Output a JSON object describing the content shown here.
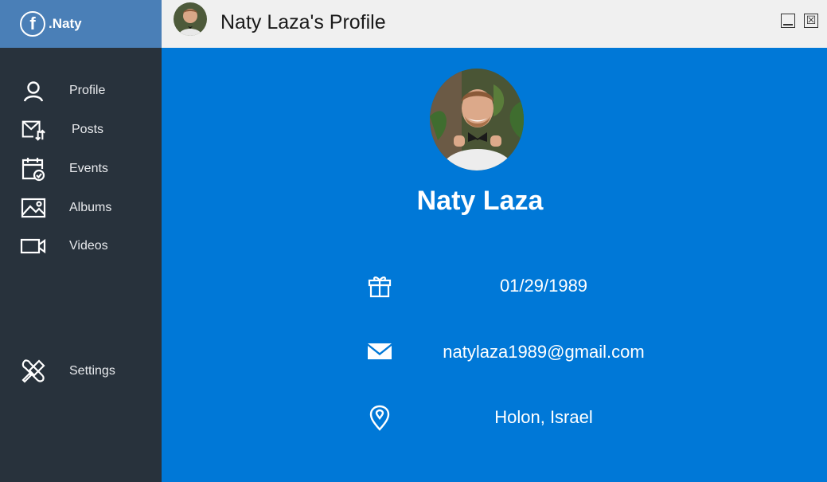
{
  "brand": {
    "logo_letter": "f",
    "name": ".Naty"
  },
  "sidebar": {
    "items": [
      {
        "label": "Profile",
        "icon": "user-icon"
      },
      {
        "label": "Posts",
        "icon": "mail-arrows-icon"
      },
      {
        "label": "Events",
        "icon": "calendar-check-icon"
      },
      {
        "label": "Albums",
        "icon": "image-icon"
      },
      {
        "label": "Videos",
        "icon": "video-icon"
      },
      {
        "label": "Settings",
        "icon": "tools-icon"
      }
    ]
  },
  "window": {
    "title": "Naty Laza's Profile",
    "close_glyph": "☒"
  },
  "profile": {
    "name": "Naty Laza",
    "birthday": "01/29/1989",
    "email": "natylaza1989@gmail.com",
    "location": "Holon, Israel"
  },
  "colors": {
    "sidebar": "#28323c",
    "brand": "#4a7fb7",
    "main": "#0078d7",
    "titlebar": "#f0f0f0"
  }
}
